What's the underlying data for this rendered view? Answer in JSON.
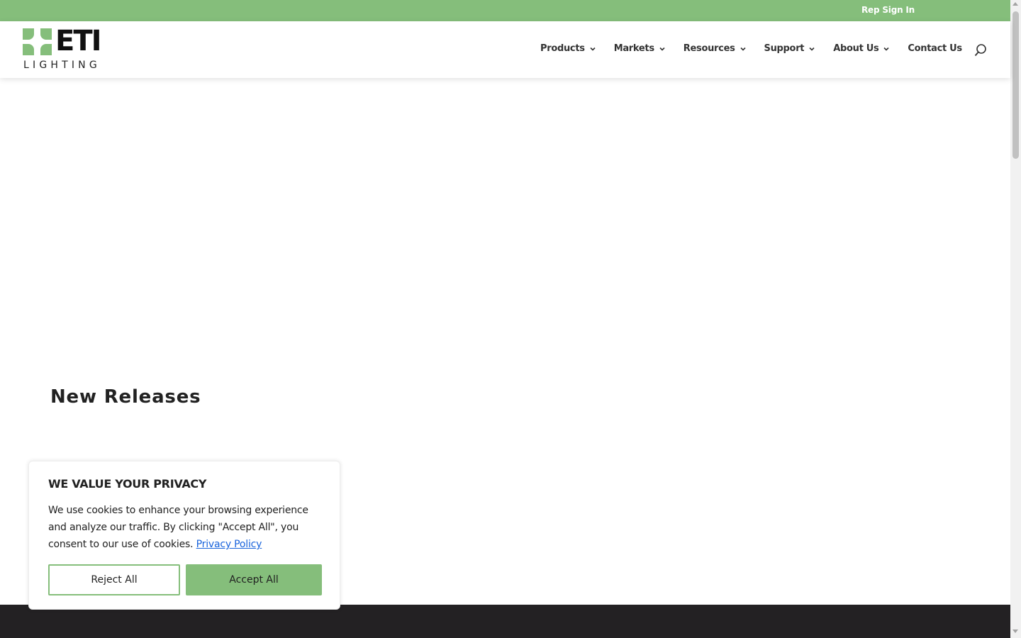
{
  "topbar": {
    "rep_sign_in": "Rep Sign In"
  },
  "brand": {
    "name": "ETI",
    "sub": "LIGHTING"
  },
  "nav": {
    "items": [
      {
        "label": "Products",
        "has_dropdown": true
      },
      {
        "label": "Markets",
        "has_dropdown": true
      },
      {
        "label": "Resources",
        "has_dropdown": true
      },
      {
        "label": "Support",
        "has_dropdown": true
      },
      {
        "label": "About Us",
        "has_dropdown": true
      },
      {
        "label": "Contact Us",
        "has_dropdown": false
      }
    ]
  },
  "section": {
    "title_light": "New",
    "title_bold": "Releases"
  },
  "cookie": {
    "title": "WE VALUE YOUR PRIVACY",
    "text": "We use cookies to enhance your browsing experience and analyze our traffic. By clicking \"Accept All\", you consent to our use of cookies.",
    "link": "Privacy Policy",
    "reject": "Reject All",
    "accept": "Accept All"
  },
  "colors": {
    "brand_green": "#85be7b",
    "footer_dark": "#232123",
    "link_blue": "#1863dc"
  }
}
